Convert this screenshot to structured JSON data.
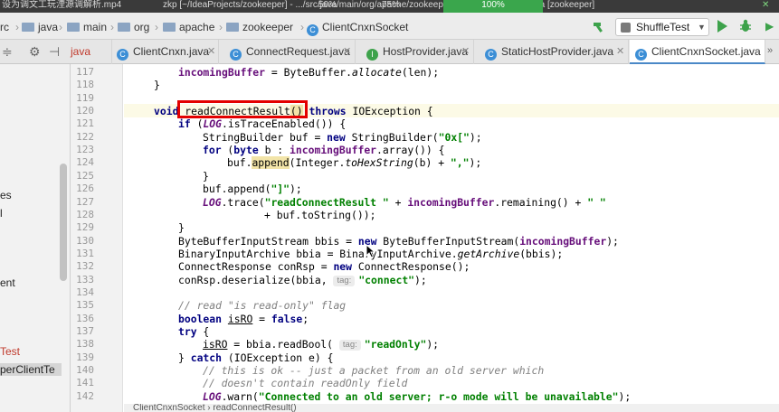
{
  "titlebar": {
    "left_text": "设为调文工玩湮源调解析.mp4",
    "path_text": "zkp [~/IdeaProjects/zookeeper] - .../src/java/main/org/apache/zookeeper/ClientCnxnSocket.java [zookeeper]",
    "pct1": "50%",
    "pct2": "75%",
    "pct3": "100%"
  },
  "breadcrumb": [
    {
      "label": "rc",
      "icon": "folder-icon"
    },
    {
      "label": "java",
      "icon": "folder-icon"
    },
    {
      "label": "main",
      "icon": "folder-icon"
    },
    {
      "label": "org",
      "icon": "folder-icon"
    },
    {
      "label": "apache",
      "icon": "folder-icon"
    },
    {
      "label": "zookeeper",
      "icon": "folder-icon"
    },
    {
      "label": "ClientCnxnSocket",
      "icon": "class-icon"
    }
  ],
  "run_config": {
    "label": "ShuffleTest",
    "icon": "junit-icon"
  },
  "tabs": [
    {
      "label": "java",
      "partial": true
    },
    {
      "label": "ClientCnxn.java",
      "icon": "class-icon",
      "color": "#3d8fd6"
    },
    {
      "label": "ConnectRequest.java",
      "icon": "class-icon",
      "color": "#3d8fd6"
    },
    {
      "label": "HostProvider.java",
      "icon": "interface-icon",
      "color": "#3da24b"
    },
    {
      "label": "StaticHostProvider.java",
      "icon": "class-icon",
      "color": "#3d8fd6"
    },
    {
      "label": "ClientCnxnSocket.java",
      "icon": "class-icon",
      "color": "#3d8fd6",
      "active": true
    }
  ],
  "project_items": [
    {
      "label": "es"
    },
    {
      "label": "l"
    },
    {
      "label": "ent"
    },
    {
      "label": "Test",
      "red": true
    },
    {
      "label": "perClientTe",
      "selected": true
    }
  ],
  "line_numbers": [
    "117",
    "118",
    "119",
    "120",
    "121",
    "122",
    "123",
    "124",
    "125",
    "126",
    "127",
    "128",
    "129",
    "130",
    "131",
    "132",
    "133",
    "134",
    "135",
    "136",
    "137",
    "138",
    "139",
    "140",
    "141",
    "142"
  ],
  "code": {
    "l117": {
      "a": "incomingBuffer",
      "b": " = ByteBuffer.",
      "c": "allocate",
      "d": "(len);"
    },
    "l118": "}",
    "l120": {
      "kw1": "void",
      "m": "readConnectResult",
      "p": "()",
      "kw2": "throws",
      "rest": " IOException {"
    },
    "l121": {
      "kw": "if",
      "a": " (",
      "f": "LOG",
      "b": ".isTraceEnabled()) {"
    },
    "l122": {
      "a": "StringBuilder buf = ",
      "kw": "new",
      "b": " StringBuilder(",
      "s": "\"0x[\"",
      "c": ");"
    },
    "l123": {
      "kw1": "for",
      "a": " (",
      "kw2": "byte",
      "b": " b : ",
      "f": "incomingBuffer",
      "c": ".array()) {"
    },
    "l124": {
      "a": "buf.",
      "m": "append",
      "b": "(Integer.",
      "c": "toHexString",
      "d": "(b) + ",
      "s": "\",\"",
      "e": ");"
    },
    "l125": "}",
    "l126": {
      "a": "buf.append(",
      "s": "\"]\"",
      "b": ");"
    },
    "l127": {
      "f": "LOG",
      "a": ".trace(",
      "s": "\"readConnectResult \"",
      "b": " + ",
      "f2": "incomingBuffer",
      "c": ".remaining() + ",
      "s2": "\" \""
    },
    "l128": "+ buf.toString());",
    "l129": "}",
    "l130": {
      "a": "ByteBufferInputStream bbis = ",
      "kw": "new",
      "b": " ByteBufferInputStream(",
      "f": "incomingBuffer",
      "c": ");"
    },
    "l131": {
      "a": "BinaryInputArchive bbia = BinaryInputArchive.",
      "c": "getArchive",
      "d": "(bbis);"
    },
    "l132": {
      "a": "ConnectResponse conRsp = ",
      "kw": "new",
      "b": " ConnectResponse();"
    },
    "l133": {
      "a": "conRsp.deserialize(bbia, ",
      "hint": "tag:",
      "s": "\"connect\"",
      "b": ");"
    },
    "l135": "// read \"is read-only\" flag",
    "l136": {
      "kw1": "boolean",
      "v": "isRO",
      "a": " = ",
      "kw2": "false",
      "b": ";"
    },
    "l137": {
      "kw": "try",
      "a": " {"
    },
    "l138": {
      "v": "isRO",
      "a": " = bbia.readBool( ",
      "hint": "tag:",
      "s": "\"readOnly\"",
      "b": ");"
    },
    "l139": {
      "a": "} ",
      "kw": "catch",
      "b": " (IOException e) {"
    },
    "l140": "// this is ok -- just a packet from an old server which",
    "l141": "// doesn't contain readOnly field",
    "l142": {
      "f": "LOG",
      "a": ".warn(",
      "s": "\"Connected to an old server; r-o mode will be unavailable\"",
      "b": ");"
    }
  },
  "status_breadcrumb": "ClientCnxnSocket  ›  readConnectResult()"
}
